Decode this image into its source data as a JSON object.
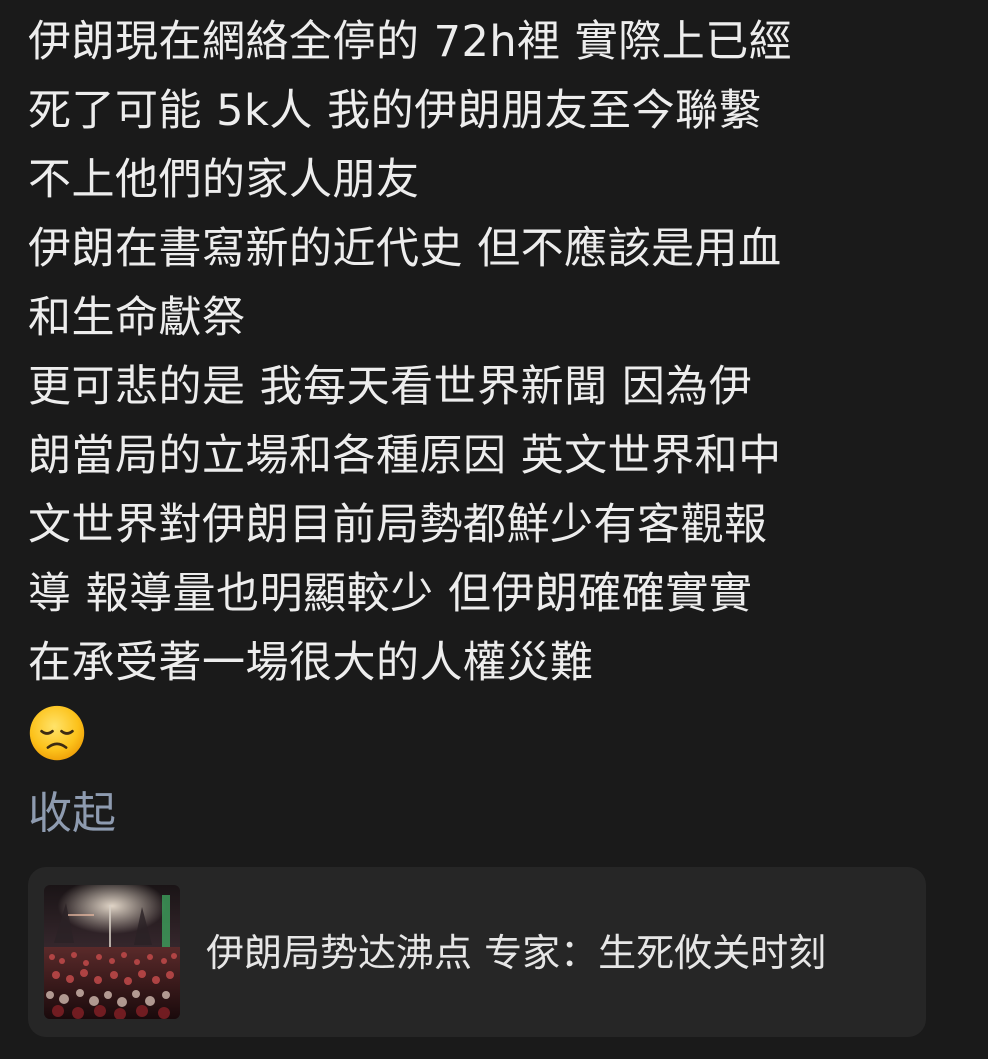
{
  "post": {
    "lines": [
      "伊朗現在網絡全停的 72h裡 實際上已經",
      "死了可能 5k人 我的伊朗朋友至今聯繫",
      "不上他們的家人朋友",
      "伊朗在書寫新的近代史 但不應該是用血",
      "和生命獻祭",
      "更可悲的是 我每天看世界新聞 因為伊",
      "朗當局的立場和各種原因 英文世界和中",
      "文世界對伊朗目前局勢都鮮少有客觀報",
      "導 報導量也明顯較少 但伊朗確確實實",
      "在承受著一場很大的人權災難"
    ],
    "emoji": "disappointed-face",
    "collapse_label": "收起"
  },
  "link_card": {
    "title": "伊朗局势达沸点 专家：生死攸关时刻",
    "thumbnail": "night-crowd-photo"
  },
  "colors": {
    "background": "#1a1a1a",
    "text": "#ededed",
    "link": "#8e9bb0",
    "card_background": "#262626"
  }
}
